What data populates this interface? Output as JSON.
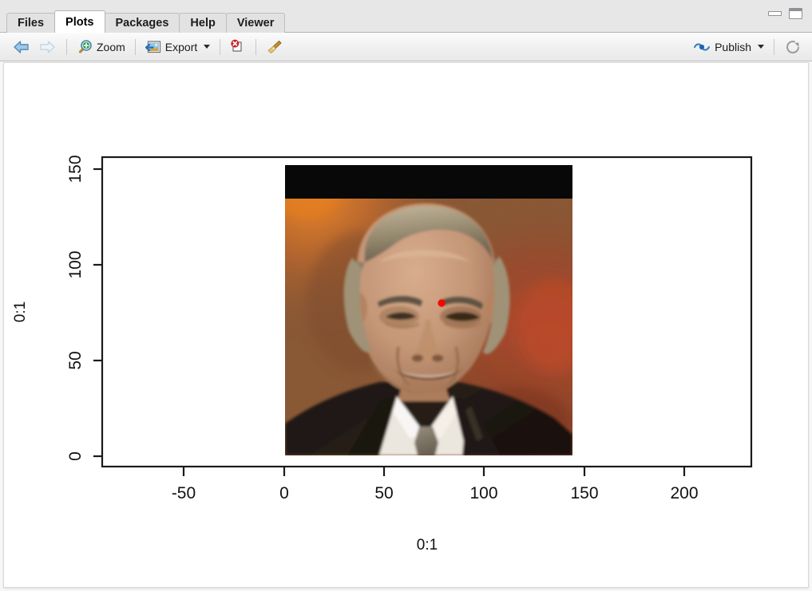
{
  "window": {
    "minimize_label": "minimize",
    "maximize_label": "maximize"
  },
  "tabs": [
    {
      "label": "Files",
      "active": false
    },
    {
      "label": "Plots",
      "active": true
    },
    {
      "label": "Packages",
      "active": false
    },
    {
      "label": "Help",
      "active": false
    },
    {
      "label": "Viewer",
      "active": false
    }
  ],
  "toolbar": {
    "back_icon": "arrow-left-icon",
    "forward_icon": "arrow-right-icon",
    "zoom_label": "Zoom",
    "zoom_icon": "magnifier-plus-icon",
    "export_label": "Export",
    "export_icon": "image-export-icon",
    "export_caret": "chevron-down-icon",
    "remove_plot_icon": "page-remove-red-x-icon",
    "clear_plots_icon": "broom-icon",
    "publish_label": "Publish",
    "publish_icon": "publish-icon",
    "publish_caret": "chevron-down-icon",
    "refresh_icon": "refresh-icon"
  },
  "chart_data": {
    "type": "scatter",
    "title": "",
    "xlabel": "0:1",
    "ylabel": "0:1",
    "xlim": [
      -88,
      238
    ],
    "ylim": [
      -9,
      159
    ],
    "xticks": [
      -50,
      0,
      50,
      100,
      150,
      200
    ],
    "yticks": [
      0,
      50,
      100,
      150
    ],
    "xtick_labels": [
      "-50",
      "0",
      "50",
      "100",
      "150",
      "200"
    ],
    "ytick_labels": [
      "0",
      "50",
      "100",
      "150"
    ],
    "grid": false,
    "legend": false,
    "raster_image": {
      "description": "photograph of a smiling man in a dark suit with white shirt and grey tie, warm brown blurred stage background, black band across the top of the frame",
      "x_range": [
        0,
        145
      ],
      "y_range": [
        0,
        146
      ],
      "top_band_color": "#080808",
      "background_color": "#8a5636",
      "accent_color": "#c8622a"
    },
    "points": [
      {
        "x": 80,
        "y": 79,
        "color": "#FF0000",
        "size": 9,
        "label": "red point marker"
      }
    ]
  }
}
